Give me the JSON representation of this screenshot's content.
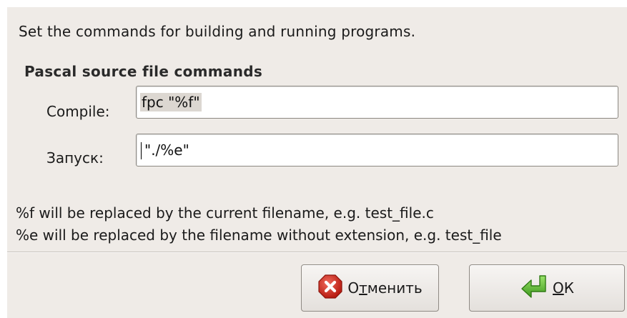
{
  "dialog": {
    "intro": "Set the commands for building and running programs.",
    "group_title": "Pascal source file commands",
    "compile": {
      "label": "Compile:",
      "value": "fpc \"%f\""
    },
    "run": {
      "label": "Запуск:",
      "value": "\"./%e\""
    },
    "hints": [
      "%f will be replaced by the current filename, e.g. test_file.c",
      "%e will be replaced by the filename without extension, e.g. test_file"
    ],
    "buttons": {
      "cancel": {
        "pre": "О",
        "mnemonic": "т",
        "post": "менить",
        "icon": "cancel-icon",
        "icon_color": "#d42a1f"
      },
      "ok": {
        "pre": "",
        "mnemonic": "О",
        "post": "К",
        "icon": "enter-arrow-icon",
        "icon_color": "#4aa82a"
      }
    }
  }
}
